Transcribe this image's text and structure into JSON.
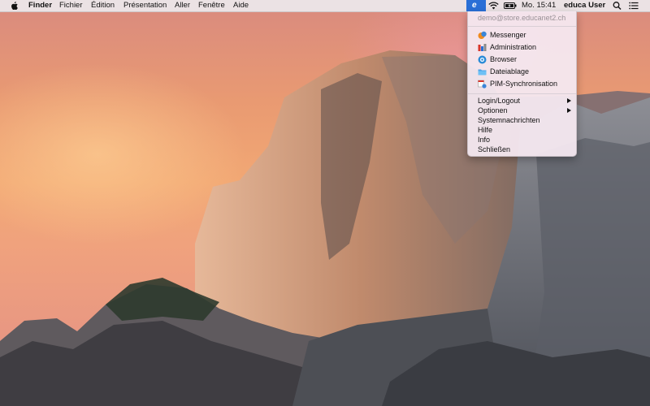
{
  "menubar": {
    "apple_icon": "apple-logo-icon",
    "app_name": "Finder",
    "menus": [
      "Fichier",
      "Édition",
      "Présentation",
      "Aller",
      "Fenêtre",
      "Aide"
    ],
    "status": {
      "educa_icon": "educa-e-icon",
      "educa_glyph": "e",
      "wifi_icon": "wifi-icon",
      "battery_icon": "battery-icon",
      "clock": "Mo. 15:41",
      "user": "educa User",
      "search_icon": "spotlight-search-icon",
      "notifications_icon": "notification-center-icon"
    }
  },
  "dropdown": {
    "account": "demo@store.educanet2.ch",
    "apps": [
      {
        "label": "Messenger",
        "icon": "messenger-icon"
      },
      {
        "label": "Administration",
        "icon": "administration-icon"
      },
      {
        "label": "Browser",
        "icon": "browser-icon"
      },
      {
        "label": "Dateiablage",
        "icon": "folder-icon"
      },
      {
        "label": "PIM-Synchronisation",
        "icon": "pim-sync-icon"
      }
    ],
    "items": [
      {
        "label": "Login/Logout",
        "submenu": true
      },
      {
        "label": "Optionen",
        "submenu": true
      },
      {
        "label": "Systemnachrichten",
        "submenu": false
      },
      {
        "label": "Hilfe",
        "submenu": false
      },
      {
        "label": "Info",
        "submenu": false
      },
      {
        "label": "Schließen",
        "submenu": false
      }
    ]
  },
  "colors": {
    "educa_accent": "#2a6fd6",
    "menu_background": "#f4e8f0"
  }
}
